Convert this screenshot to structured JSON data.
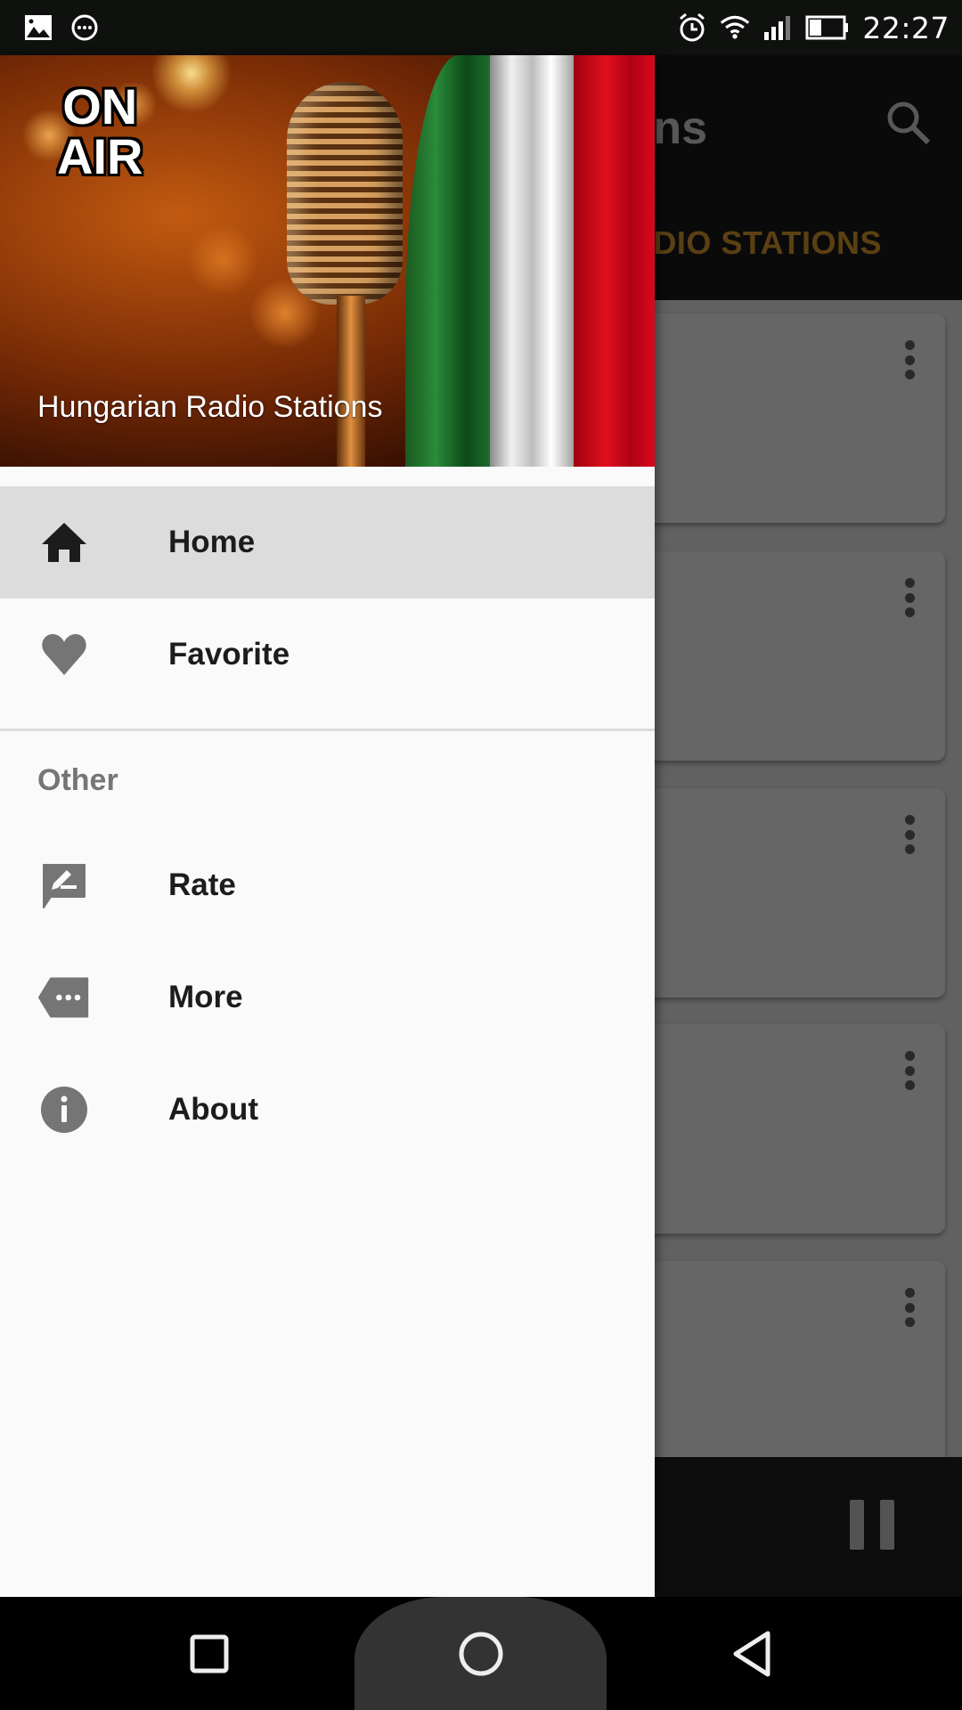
{
  "status_bar": {
    "left_icons": [
      "image-notification-icon",
      "message-notification-icon"
    ],
    "right_icons": [
      "alarm-icon",
      "wifi-icon",
      "cellular-signal-icon",
      "battery-icon"
    ],
    "time": "22:27"
  },
  "background_app": {
    "title_partial": "ns",
    "search_icon": "search-icon",
    "tab_label_partial": "ADIO STATIONS",
    "cards": [
      {
        "menu_icon": "more-vert-icon"
      },
      {
        "menu_icon": "more-vert-icon"
      },
      {
        "menu_icon": "more-vert-icon"
      },
      {
        "menu_icon": "more-vert-icon"
      },
      {
        "menu_icon": "more-vert-icon"
      }
    ],
    "mini_player": {
      "control_icon": "pause-icon"
    }
  },
  "drawer": {
    "header": {
      "image_text_line1": "ON",
      "image_text_line2": "AIR",
      "title": "Hungarian Radio Stations"
    },
    "primary_items": [
      {
        "label": "Home",
        "icon": "home-icon",
        "active": true
      },
      {
        "label": "Favorite",
        "icon": "heart-icon",
        "active": false
      }
    ],
    "section_header": "Other",
    "secondary_items": [
      {
        "label": "Rate",
        "icon": "rate-review-icon"
      },
      {
        "label": "More",
        "icon": "more-label-icon"
      },
      {
        "label": "About",
        "icon": "info-icon"
      }
    ]
  },
  "nav_bar": {
    "buttons": [
      "recents-icon",
      "home-circle-icon",
      "back-icon"
    ]
  },
  "colors": {
    "accent_tab": "#e0a030",
    "drawer_bg": "#fafafa",
    "active_item_bg": "#dcdcdc",
    "icon_gray": "#757575"
  }
}
